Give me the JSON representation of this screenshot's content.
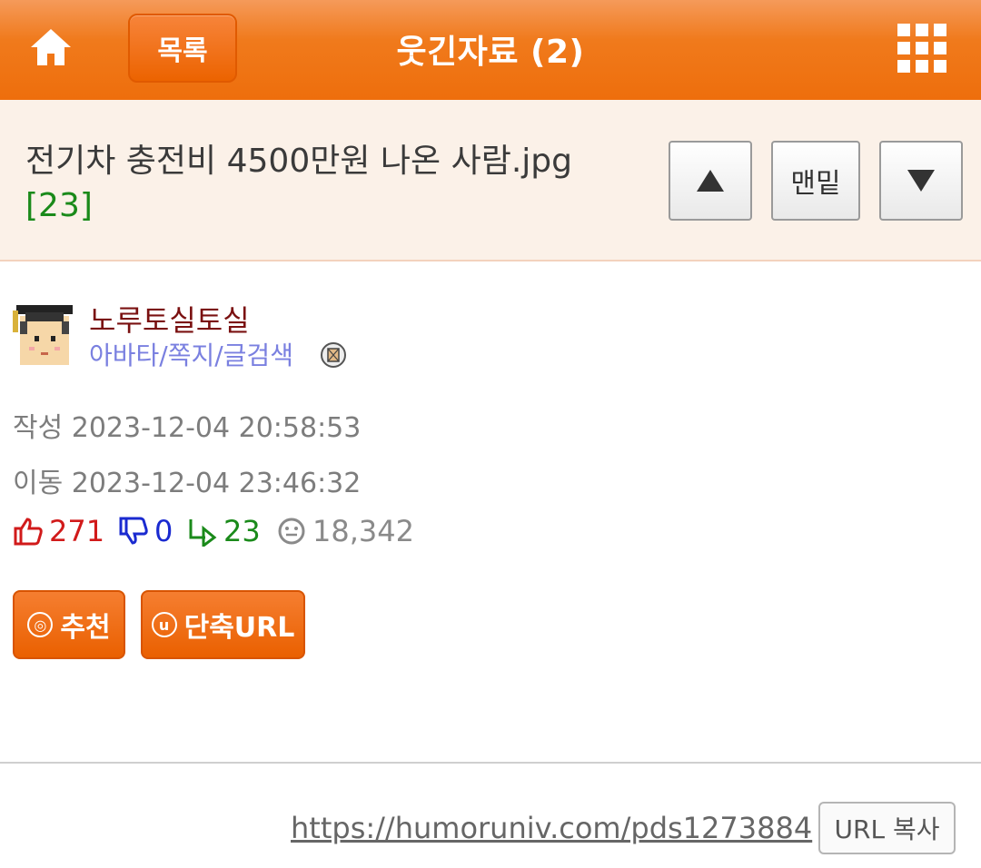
{
  "header": {
    "list_label": "목록",
    "title": "웃긴자료 (2)"
  },
  "post": {
    "title": "전기차 충전비 4500만원 나온 사람.jpg",
    "comment_count": "[23]",
    "nav": {
      "up_symbol": "▲",
      "bottom_label": "맨밑",
      "down_symbol": "▼"
    }
  },
  "author": {
    "name": "노루토실토실",
    "links": "아바타/쪽지/글검색"
  },
  "meta": {
    "written": "작성 2023-12-04 20:58:53",
    "moved": "이동 2023-12-04 23:46:32"
  },
  "stats": {
    "recommend": "271",
    "dislike": "0",
    "replies": "23",
    "views": "18,342"
  },
  "actions": {
    "recommend_label": "추천",
    "recommend_glyph": "◎",
    "shorturl_label": "단축URL",
    "shorturl_glyph": "u"
  },
  "footer": {
    "url": "https://humoruniv.com/pds1273884",
    "copy_label": "URL 복사"
  },
  "colors": {
    "header_orange": "#ee6e0c",
    "title_bg": "#fbf1e8",
    "author_name": "#7a1010",
    "author_links": "#7a80e0",
    "recommend_red": "#d11a1a",
    "dislike_blue": "#1a2ad0",
    "reply_green": "#1a8a1a"
  }
}
